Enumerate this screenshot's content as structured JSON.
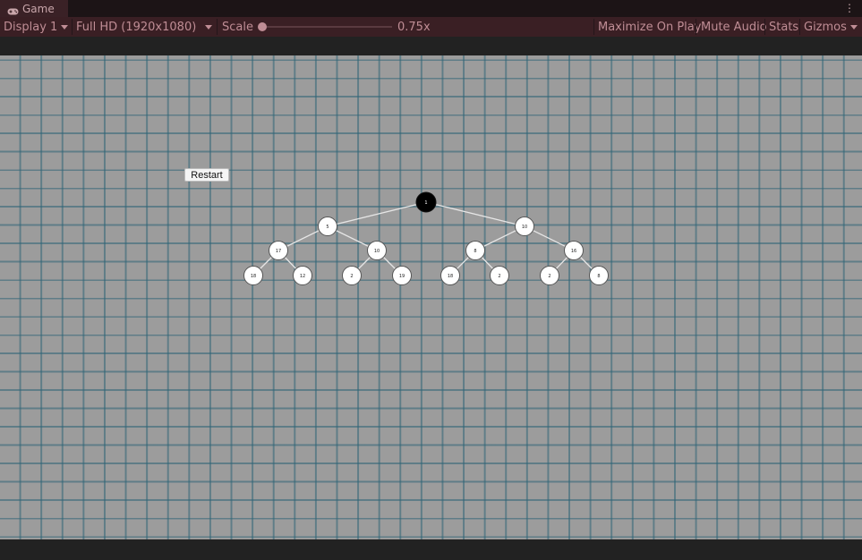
{
  "window": {
    "tab_title": "Game",
    "tab_icon": "gamepad-icon",
    "menu_icon": "kebab-menu-icon"
  },
  "toolbar": {
    "display": "Display 1",
    "resolution": "Full HD (1920x1080)",
    "scale_label": "Scale",
    "scale_value": "0.75x",
    "maximize_on_play": "Maximize On Play",
    "mute_audio": "Mute Audio",
    "stats": "Stats",
    "gizmos": "Gizmos"
  },
  "game": {
    "restart_label": "Restart",
    "tree_nodes": [
      {
        "id": "root",
        "label": "1",
        "color": "#000000"
      },
      {
        "id": "L",
        "label": "5"
      },
      {
        "id": "R",
        "label": "10"
      },
      {
        "id": "LL",
        "label": "17"
      },
      {
        "id": "LR",
        "label": "10"
      },
      {
        "id": "RL",
        "label": "8"
      },
      {
        "id": "RR",
        "label": "16"
      },
      {
        "id": "LLL",
        "label": "18"
      },
      {
        "id": "LLR",
        "label": "12"
      },
      {
        "id": "LRL",
        "label": "2"
      },
      {
        "id": "LRR",
        "label": "19"
      },
      {
        "id": "RLL",
        "label": "18"
      },
      {
        "id": "RLR",
        "label": "2"
      },
      {
        "id": "RRL",
        "label": "2"
      },
      {
        "id": "RRR",
        "label": "8"
      }
    ]
  },
  "colors": {
    "accent": "#3a1f24",
    "toolbar_text": "#bf8d95",
    "grid_line": "#2d6476",
    "viewport_bg": "#9c9c9c"
  }
}
